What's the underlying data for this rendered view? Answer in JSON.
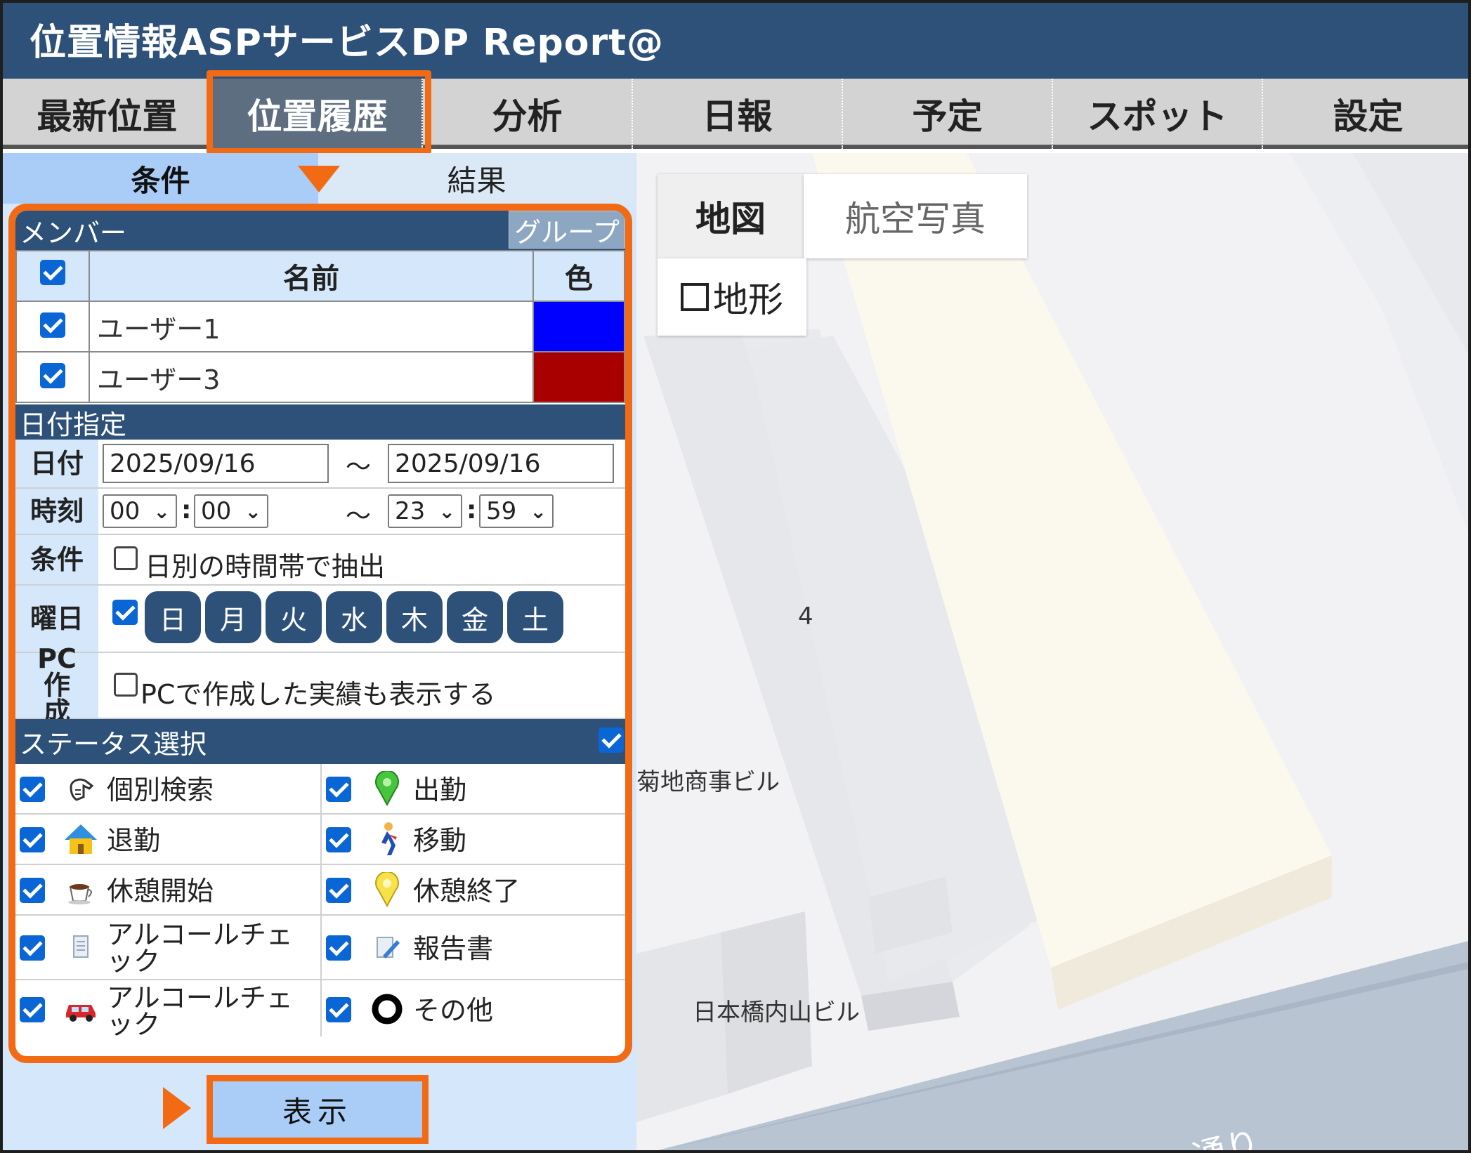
{
  "app": {
    "title": "位置情報ASPサービスDP Report@"
  },
  "nav": {
    "items": [
      {
        "label": "最新位置"
      },
      {
        "label": "位置履歴"
      },
      {
        "label": "分析"
      },
      {
        "label": "日報"
      },
      {
        "label": "予定"
      },
      {
        "label": "スポット"
      },
      {
        "label": "設定"
      }
    ],
    "active_index": 1
  },
  "subtabs": {
    "conditions": "条件",
    "results": "結果"
  },
  "members": {
    "header": "メンバー",
    "group_button": "グループ",
    "col_name": "名前",
    "col_color": "色",
    "rows": [
      {
        "name": "ユーザー1",
        "color": "#0000ff",
        "checked": true
      },
      {
        "name": "ユーザー3",
        "color": "#a80000",
        "checked": true
      }
    ]
  },
  "date": {
    "header": "日付指定",
    "date_label": "日付",
    "start_date": "2025/09/16",
    "tilde": "～",
    "end_date": "2025/09/16",
    "time_label": "時刻",
    "start_hour": "00",
    "start_min": "00",
    "end_hour": "23",
    "end_min": "59",
    "colon": ":",
    "cond_label": "条件",
    "cond_text": "日別の時間帯で抽出",
    "weekday_label": "曜日",
    "weekdays": [
      "日",
      "月",
      "火",
      "水",
      "木",
      "金",
      "土"
    ],
    "pc_label": "PC作成",
    "pc_text": "PCで作成した実績も表示する"
  },
  "status": {
    "header": "ステータス選択",
    "items": [
      {
        "label": "個別検索",
        "icon": "pointing-hand-icon"
      },
      {
        "label": "出勤",
        "icon": "green-pin-icon"
      },
      {
        "label": "退勤",
        "icon": "house-icon"
      },
      {
        "label": "移動",
        "icon": "walking-person-icon"
      },
      {
        "label": "休憩開始",
        "icon": "coffee-cup-icon"
      },
      {
        "label": "休憩終了",
        "icon": "yellow-pin-icon"
      },
      {
        "label": "アルコールチェック",
        "icon": "document-icon"
      },
      {
        "label": "報告書",
        "icon": "report-pen-icon"
      },
      {
        "label": "アルコールチェック",
        "icon": "red-car-icon"
      },
      {
        "label": "その他",
        "icon": "black-ring-icon"
      }
    ]
  },
  "show_button": "表示",
  "map": {
    "type_map": "地図",
    "type_aerial": "航空写真",
    "terrain": "地形",
    "labels": {
      "number": "4",
      "building1": "菊地商事ビル",
      "building2": "日本橋内山ビル",
      "road": "通り"
    }
  },
  "colors": {
    "header_bg": "#2d5178",
    "accent_highlight": "#f26a13",
    "panel_bg": "#d5e7fb",
    "checkbox": "#0a66d4"
  }
}
